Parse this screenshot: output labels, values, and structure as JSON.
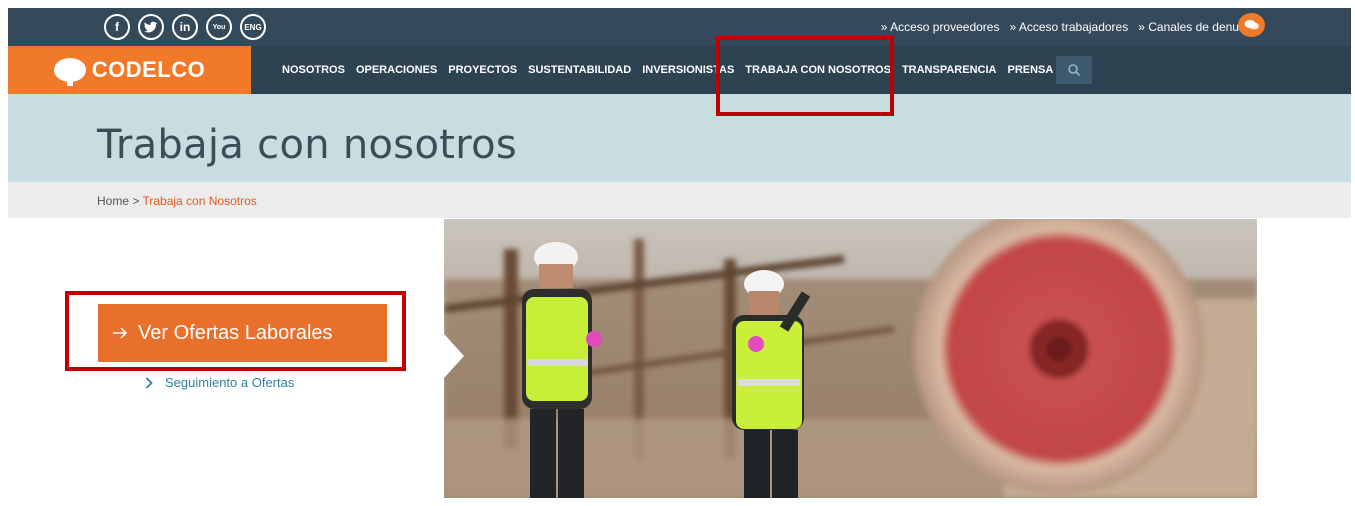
{
  "social": {
    "facebook": "f",
    "twitter": "t",
    "linkedin": "in",
    "youtube": "You",
    "language": "ENG"
  },
  "toplinks": [
    "» Acceso proveedores",
    "» Acceso trabajadores",
    "» Canales de denuncia"
  ],
  "brand": {
    "name": "CODELCO"
  },
  "nav": [
    "NOSOTROS",
    "OPERACIONES",
    "PROYECTOS",
    "SUSTENTABILIDAD",
    "INVERSIONISTAS",
    "TRABAJA CON NOSOTROS",
    "TRANSPARENCIA",
    "PRENSA"
  ],
  "page": {
    "title": "Trabaja con nosotros"
  },
  "breadcrumb": {
    "home": "Home",
    "sep": " > ",
    "current": "Trabaja con Nosotros"
  },
  "content": {
    "primary_button": "Ver Ofertas Laborales",
    "secondary_link": "Seguimiento a Ofertas"
  },
  "colors": {
    "orange": "#f07a2a",
    "navy": "#2d4352",
    "highlight": "#c00000"
  }
}
